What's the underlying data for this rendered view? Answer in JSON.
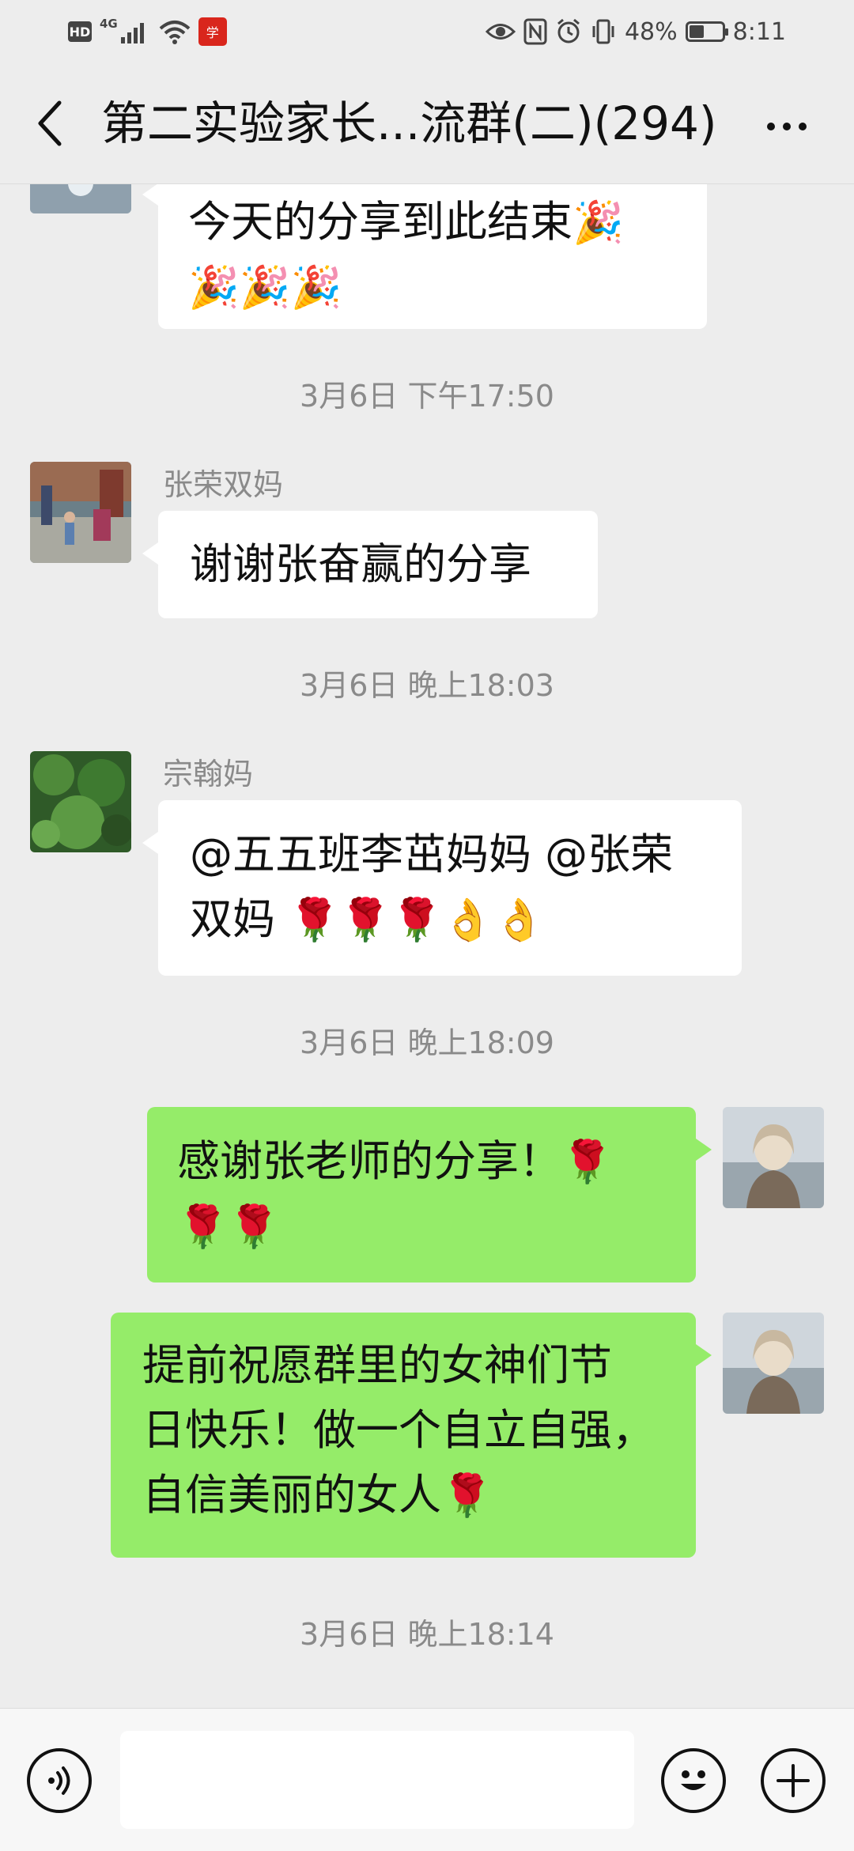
{
  "status_bar": {
    "hd": "HD",
    "network": "4G",
    "app_badge": "学",
    "battery_text": "48%",
    "battery_level": 0.48,
    "time": "8:11"
  },
  "header": {
    "title": "第二实验家长...流群(二)(294)"
  },
  "messages": {
    "m0": {
      "line1": "今天的分享到此结束",
      "emoji1": "🎉",
      "line2": "🎉🎉🎉"
    },
    "ts1": "3月6日 下午17:50",
    "m1": {
      "sender": "张荣双妈",
      "text": "谢谢张奋赢的分享"
    },
    "ts2": "3月6日 晚上18:03",
    "m2": {
      "sender": "宗翰妈",
      "line1": "@五五班李茁妈妈  @张荣",
      "line2_text": "双妈 ",
      "line2_emoji": "🌹🌹🌹👌👌"
    },
    "ts3": "3月6日 晚上18:09",
    "m3": {
      "line1_text": "感谢张老师的分享！",
      "line1_emoji": "🌹",
      "line2_emoji": "🌹🌹"
    },
    "m4": {
      "line1": "提前祝愿群里的女神们节",
      "line2": "日快乐！做一个自立自强，",
      "line3_text": "自信美丽的女人",
      "line3_emoji": "🌹"
    },
    "ts4": "3月6日 晚上18:14"
  },
  "input": {
    "placeholder": ""
  },
  "colors": {
    "background": "#ededed",
    "out_bubble": "#95ec69",
    "in_bubble": "#ffffff",
    "meta_text": "#8a8a8a"
  },
  "icons": {
    "back": "chevron-left-icon",
    "more": "more-dots-icon",
    "voice": "voice-icon",
    "emoji": "emoji-smile-icon",
    "plus": "plus-icon"
  }
}
